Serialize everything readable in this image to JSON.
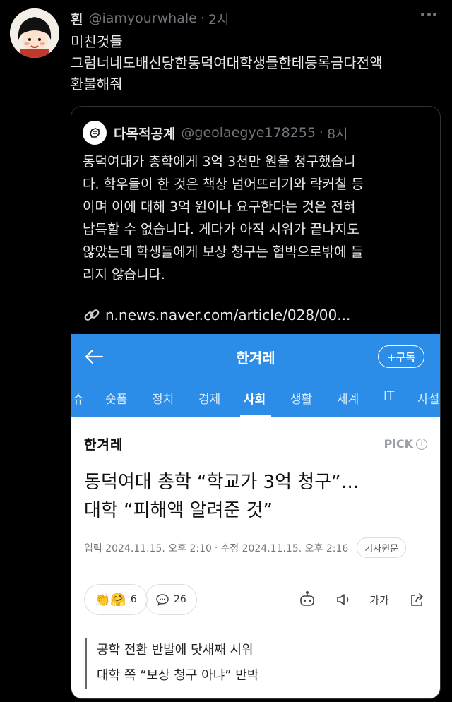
{
  "tweet": {
    "author_name": "흰",
    "handle": "@iamyourwhale",
    "dot": "·",
    "time": "2시",
    "lines": [
      "미친것들",
      "그럼너네도배신당한동덕여대학생들한테등록금다전액",
      "환불해줘"
    ]
  },
  "quote": {
    "author_name": "다목적공계",
    "handle": "@geolaegye178255",
    "dot": "·",
    "time": "8시",
    "lines": [
      "동덕여대가 총학에게 3억 3천만 원을 청구했습니",
      "다. 학우들이 한 것은 책상 넘어뜨리기와 락커칠 등",
      "이며 이에 대해 3억 원이나 요구한다는 것은 전혀",
      "납득할 수 없습니다. 게다가 아직 시위가 끝나지도",
      "않았는데 학생들에게 보상 청구는 협박으로밖에 들",
      "리지 않습니다."
    ],
    "link": "n.news.naver.com/article/028/00..."
  },
  "article": {
    "brand": "한겨레",
    "subscribe": "+구독",
    "tabs": [
      "슈",
      "숏폼",
      "정치",
      "경제",
      "사회",
      "생활",
      "세계",
      "IT",
      "사설"
    ],
    "active_tab": "사회",
    "press": "한겨레",
    "pick": "PiCK",
    "info": "i",
    "headline": [
      "동덕여대 총학 “학교가 3억 청구”…",
      "대학 “피해액 알려준 것”"
    ],
    "published": "입력 2024.11.15. 오후 2:10",
    "sep": "·",
    "modified": "수정 2024.11.15. 오후 2:16",
    "original": "기사원문",
    "reaction_count": "6",
    "comment_count": "26",
    "font_size_label": "가가",
    "summary": [
      "공학 전환 반발에 닷새째 시위",
      "대학 쪽 “보상 청구 아냐” 반박"
    ]
  },
  "colors": {
    "background": "#000000",
    "brand_blue": "#2b8de8",
    "muted": "#71767b"
  }
}
